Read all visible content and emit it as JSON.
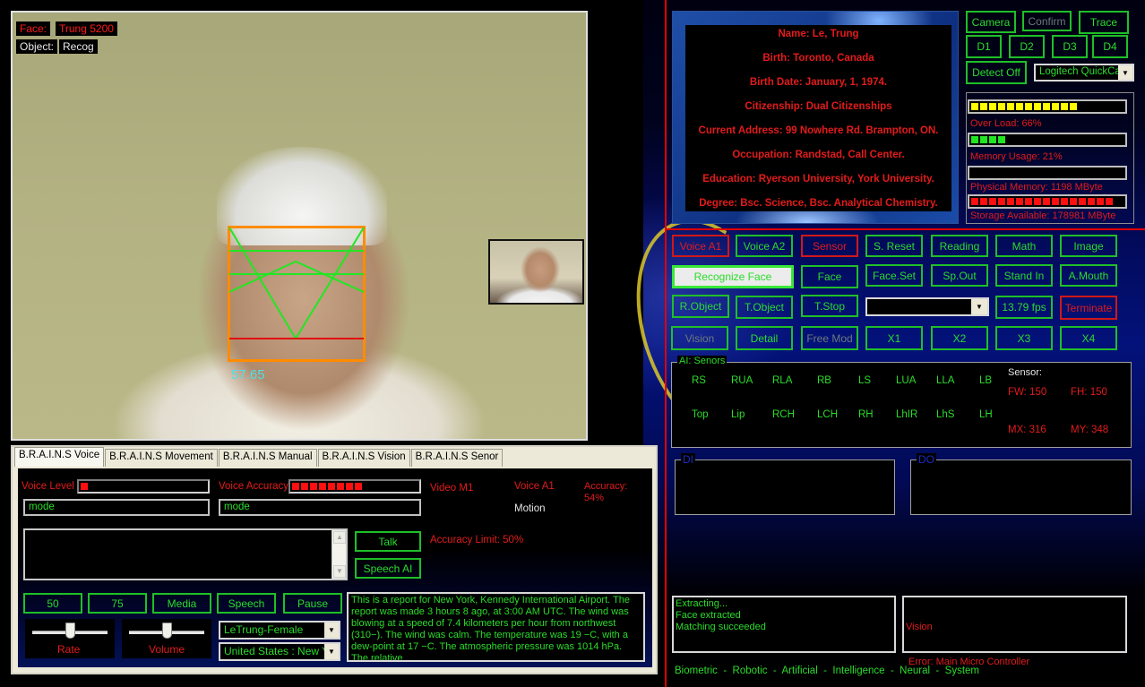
{
  "camera": {
    "face_label": "Face:",
    "face_value": "Trung 5200",
    "object_label": "Object:",
    "object_value": "Recog",
    "face_score": "57.65"
  },
  "tabs": [
    {
      "label": "B.R.A.I.N.S Voice",
      "active": true
    },
    {
      "label": "B.R.A.I.N.S Movement",
      "active": false
    },
    {
      "label": "B.R.A.I.N.S Manual",
      "active": false
    },
    {
      "label": "B.R.A.I.N.S Vision",
      "active": false
    },
    {
      "label": "B.R.A.I.N.S Senor",
      "active": false
    }
  ],
  "voice": {
    "voice_level_label": "Voice Level",
    "voice_level_value": 0.05,
    "voice_accuracy_label": "Voice Accuracy",
    "voice_accuracy_value": 0.55,
    "mode_left": "mode",
    "mode_right": "mode",
    "video_m1": "Video M1",
    "voice_a1": "Voice A1",
    "motion": "Motion",
    "accuracy": "Accuracy: 54%",
    "accuracy_limit": "Accuracy Limit: 50%",
    "talk_button": "Talk",
    "speech_ai_button": "Speech AI",
    "speech_text": "",
    "buttons": [
      "50",
      "75",
      "Media",
      "Speech",
      "Pause"
    ],
    "rate_label": "Rate",
    "rate_value": 0.5,
    "volume_label": "Volume",
    "volume_value": 0.5,
    "voice_select": "LeTrung-Female",
    "region_select": "United States : New Yo",
    "weather_report": "This is a report for New York, Kennedy International Airport. The report was made 3 hours 8 ago, at 3:00 AM UTC. The wind was blowing at a speed of 7.4 kilometers per hour from northwest (310−). The wind was calm. The temperature was 19 −C, with a dew-point at 17 −C. The atmospheric pressure was 1014 hPa. The relative"
  },
  "profile": {
    "lines": [
      "Name: Le, Trung",
      "Birth: Toronto, Canada",
      "Birth Date: January, 1, 1974.",
      "Citizenship: Dual Citizenships",
      "Current Address: 99 Nowhere Rd. Brampton, ON.",
      "Occupation: Randstad, Call Center.",
      "Education: Ryerson University, York University.",
      "Degree: Bsc. Science, Bsc. Analytical Chemistry."
    ]
  },
  "top_controls": {
    "camera": "Camera",
    "confirm": "Confirm",
    "trace": "Trace",
    "d_buttons": [
      "D1",
      "D2",
      "D3",
      "D4"
    ],
    "detect_off": "Detect Off",
    "camera_select": "Logitech QuickCam"
  },
  "stats": {
    "overload_label": "Over Load: 66%",
    "overload_value": 0.66,
    "memory_label": "Memory Usage: 21%",
    "memory_value": 0.21,
    "physical_label": "Physical Memory: 1198 MByte",
    "physical_value": 0,
    "storage_label": "Storage Available: 178981 MByte",
    "storage_value": 0.89,
    "colors": {
      "overload": "#ffff00",
      "memory": "#22e622",
      "storage": "#ff1010"
    }
  },
  "control_grid": [
    [
      {
        "label": "Voice A1",
        "style": "red"
      },
      {
        "label": "Voice A2",
        "style": "green"
      },
      {
        "label": "Sensor",
        "style": "red"
      },
      {
        "label": "S. Reset",
        "style": "green"
      },
      {
        "label": "Reading",
        "style": "green"
      },
      {
        "label": "Math",
        "style": "green"
      },
      {
        "label": "Image",
        "style": "green"
      }
    ],
    [
      {
        "label": "Recognize Face",
        "style": "selected"
      },
      {
        "label": "Face",
        "style": "green"
      },
      {
        "label": "Face.Set",
        "style": "green"
      },
      {
        "label": "Sp.Out",
        "style": "green"
      },
      {
        "label": "Stand In",
        "style": "green"
      },
      {
        "label": "A.Mouth",
        "style": "green"
      }
    ],
    [
      {
        "label": "R.Object",
        "style": "green"
      },
      {
        "label": "T.Object",
        "style": "green"
      },
      {
        "label": "T.Stop",
        "style": "green"
      },
      {
        "label": "13.79 fps",
        "style": "green"
      },
      {
        "label": "Terminate",
        "style": "red"
      }
    ],
    [
      {
        "label": "Vision",
        "style": "disabled"
      },
      {
        "label": "Detail",
        "style": "green"
      },
      {
        "label": "Free Mod",
        "style": "disabled"
      },
      {
        "label": "X1",
        "style": "green"
      },
      {
        "label": "X2",
        "style": "green"
      },
      {
        "label": "X3",
        "style": "green"
      },
      {
        "label": "X4",
        "style": "green"
      }
    ]
  ],
  "mode_select": "",
  "sensors": {
    "title": "AI: Senors",
    "row1": [
      "RS",
      "RUA",
      "RLA",
      "RB",
      "LS",
      "LUA",
      "LLA",
      "LB"
    ],
    "row2": [
      "Top",
      "Lip",
      "RCH",
      "LCH",
      "RH",
      "LhIR",
      "LhS",
      "LH"
    ],
    "sensor_label": "Sensor:",
    "fw": "FW: 150",
    "fh": "FH: 150",
    "mx": "MX: 316",
    "my": "MY: 348"
  },
  "di_title": "DI",
  "do_title": "DO",
  "log_left": [
    "Extracting...",
    "Face extracted",
    "Matching succeeded"
  ],
  "log_right": [
    "Vision",
    " Error: Main Micro Controller"
  ],
  "footer": "Biometric  -  Robotic  -  Artificial  -  Intelligence  -  Neural  -  System"
}
